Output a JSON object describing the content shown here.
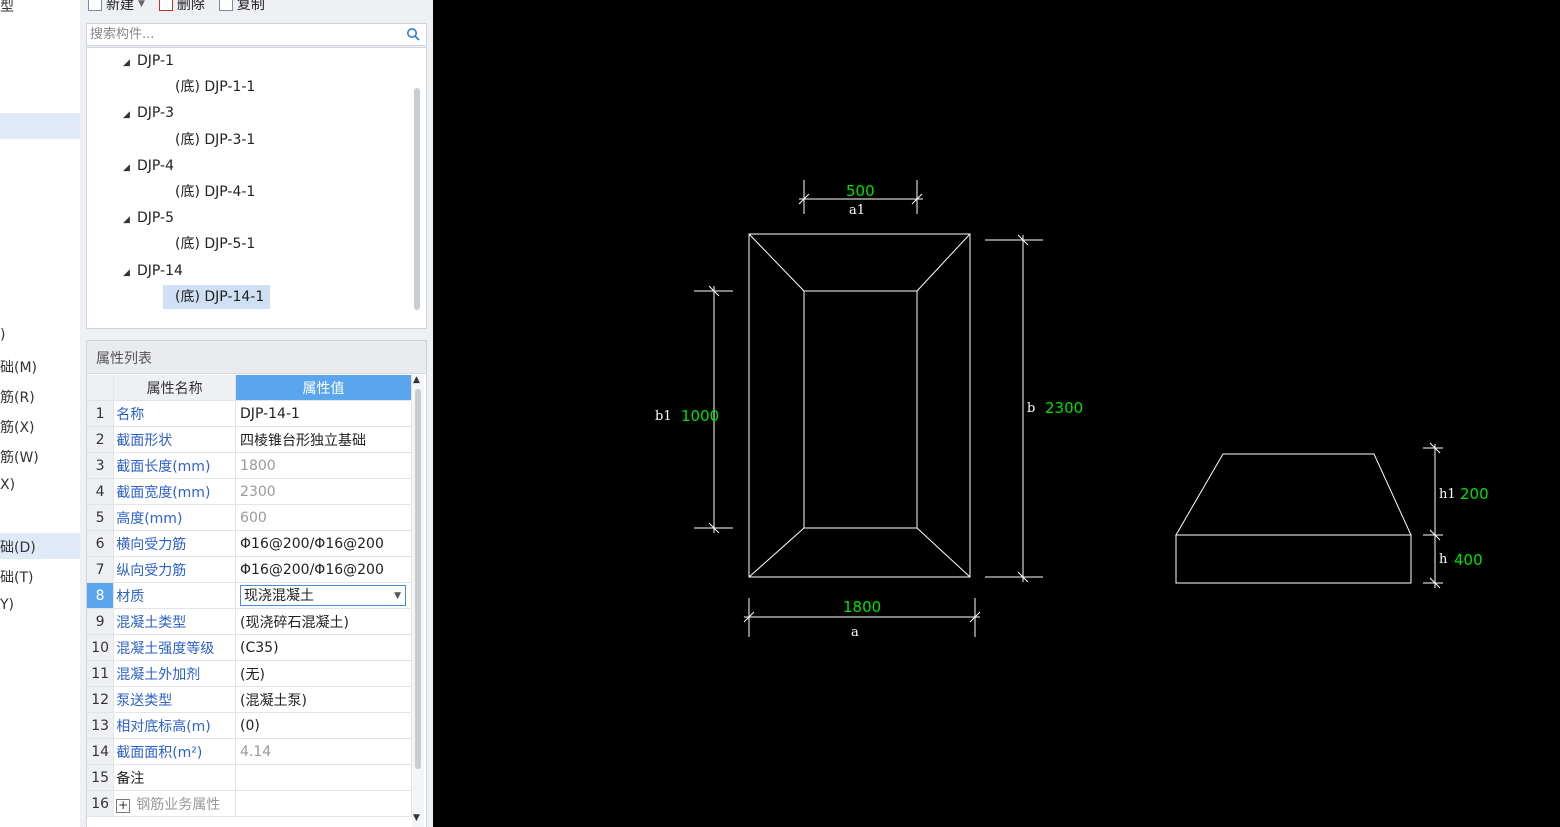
{
  "left_strip": {
    "fragments": [
      "型",
      ")",
      "础(M)",
      "筋(R)",
      "筋(X)",
      "筋(W)",
      "X)",
      "础(D)",
      "础(T)",
      "Y)"
    ]
  },
  "toolbar": {
    "new_label": "新建",
    "delete_label": "删除",
    "copy_label": "复制"
  },
  "search": {
    "placeholder": "搜索构件..."
  },
  "tree": {
    "items": [
      {
        "label": "DJP-1",
        "level": 0
      },
      {
        "label": "(底) DJP-1-1",
        "level": 1
      },
      {
        "label": "DJP-3",
        "level": 0
      },
      {
        "label": "(底) DJP-3-1",
        "level": 1
      },
      {
        "label": "DJP-4",
        "level": 0
      },
      {
        "label": "(底) DJP-4-1",
        "level": 1
      },
      {
        "label": "DJP-5",
        "level": 0
      },
      {
        "label": "(底) DJP-5-1",
        "level": 1
      },
      {
        "label": "DJP-14",
        "level": 0
      },
      {
        "label": "(底) DJP-14-1",
        "level": 1,
        "selected": true
      }
    ]
  },
  "properties": {
    "title": "属性列表",
    "header_name": "属性名称",
    "header_value": "属性值",
    "rows": [
      {
        "idx": "1",
        "name": "名称",
        "value": "DJP-14-1"
      },
      {
        "idx": "2",
        "name": "截面形状",
        "value": "四棱锥台形独立基础"
      },
      {
        "idx": "3",
        "name": "截面长度(mm)",
        "value": "1800"
      },
      {
        "idx": "4",
        "name": "截面宽度(mm)",
        "value": "2300"
      },
      {
        "idx": "5",
        "name": "高度(mm)",
        "value": "600"
      },
      {
        "idx": "6",
        "name": "横向受力筋",
        "value": "Φ16@200/Φ16@200"
      },
      {
        "idx": "7",
        "name": "纵向受力筋",
        "value": "Φ16@200/Φ16@200"
      },
      {
        "idx": "8",
        "name": "材质",
        "value": "现浇混凝土"
      },
      {
        "idx": "9",
        "name": "混凝土类型",
        "value": "(现浇碎石混凝土)"
      },
      {
        "idx": "10",
        "name": "混凝土强度等级",
        "value": "(C35)"
      },
      {
        "idx": "11",
        "name": "混凝土外加剂",
        "value": "(无)"
      },
      {
        "idx": "12",
        "name": "泵送类型",
        "value": "(混凝土泵)"
      },
      {
        "idx": "13",
        "name": "相对底标高(m)",
        "value": "(0)"
      },
      {
        "idx": "14",
        "name": "截面面积(m²)",
        "value": "4.14"
      },
      {
        "idx": "15",
        "name": "备注",
        "value": ""
      },
      {
        "idx": "16",
        "name": "钢筋业务属性",
        "value": ""
      }
    ]
  },
  "drawing": {
    "a1_value": "500",
    "a1_label": "a1",
    "b1_value": "1000",
    "b1_label": "b1",
    "b_value": "2300",
    "b_label": "b",
    "a_value": "1800",
    "a_label": "a",
    "h1_value": "200",
    "h1_label": "h1",
    "h_value": "400",
    "h_label": "h"
  },
  "colors": {
    "canvas_bg": "#000000",
    "dimension_value": "#00e000",
    "line": "#ffffff",
    "accent": "#5aa6ee",
    "link_text": "#2d62c9"
  }
}
